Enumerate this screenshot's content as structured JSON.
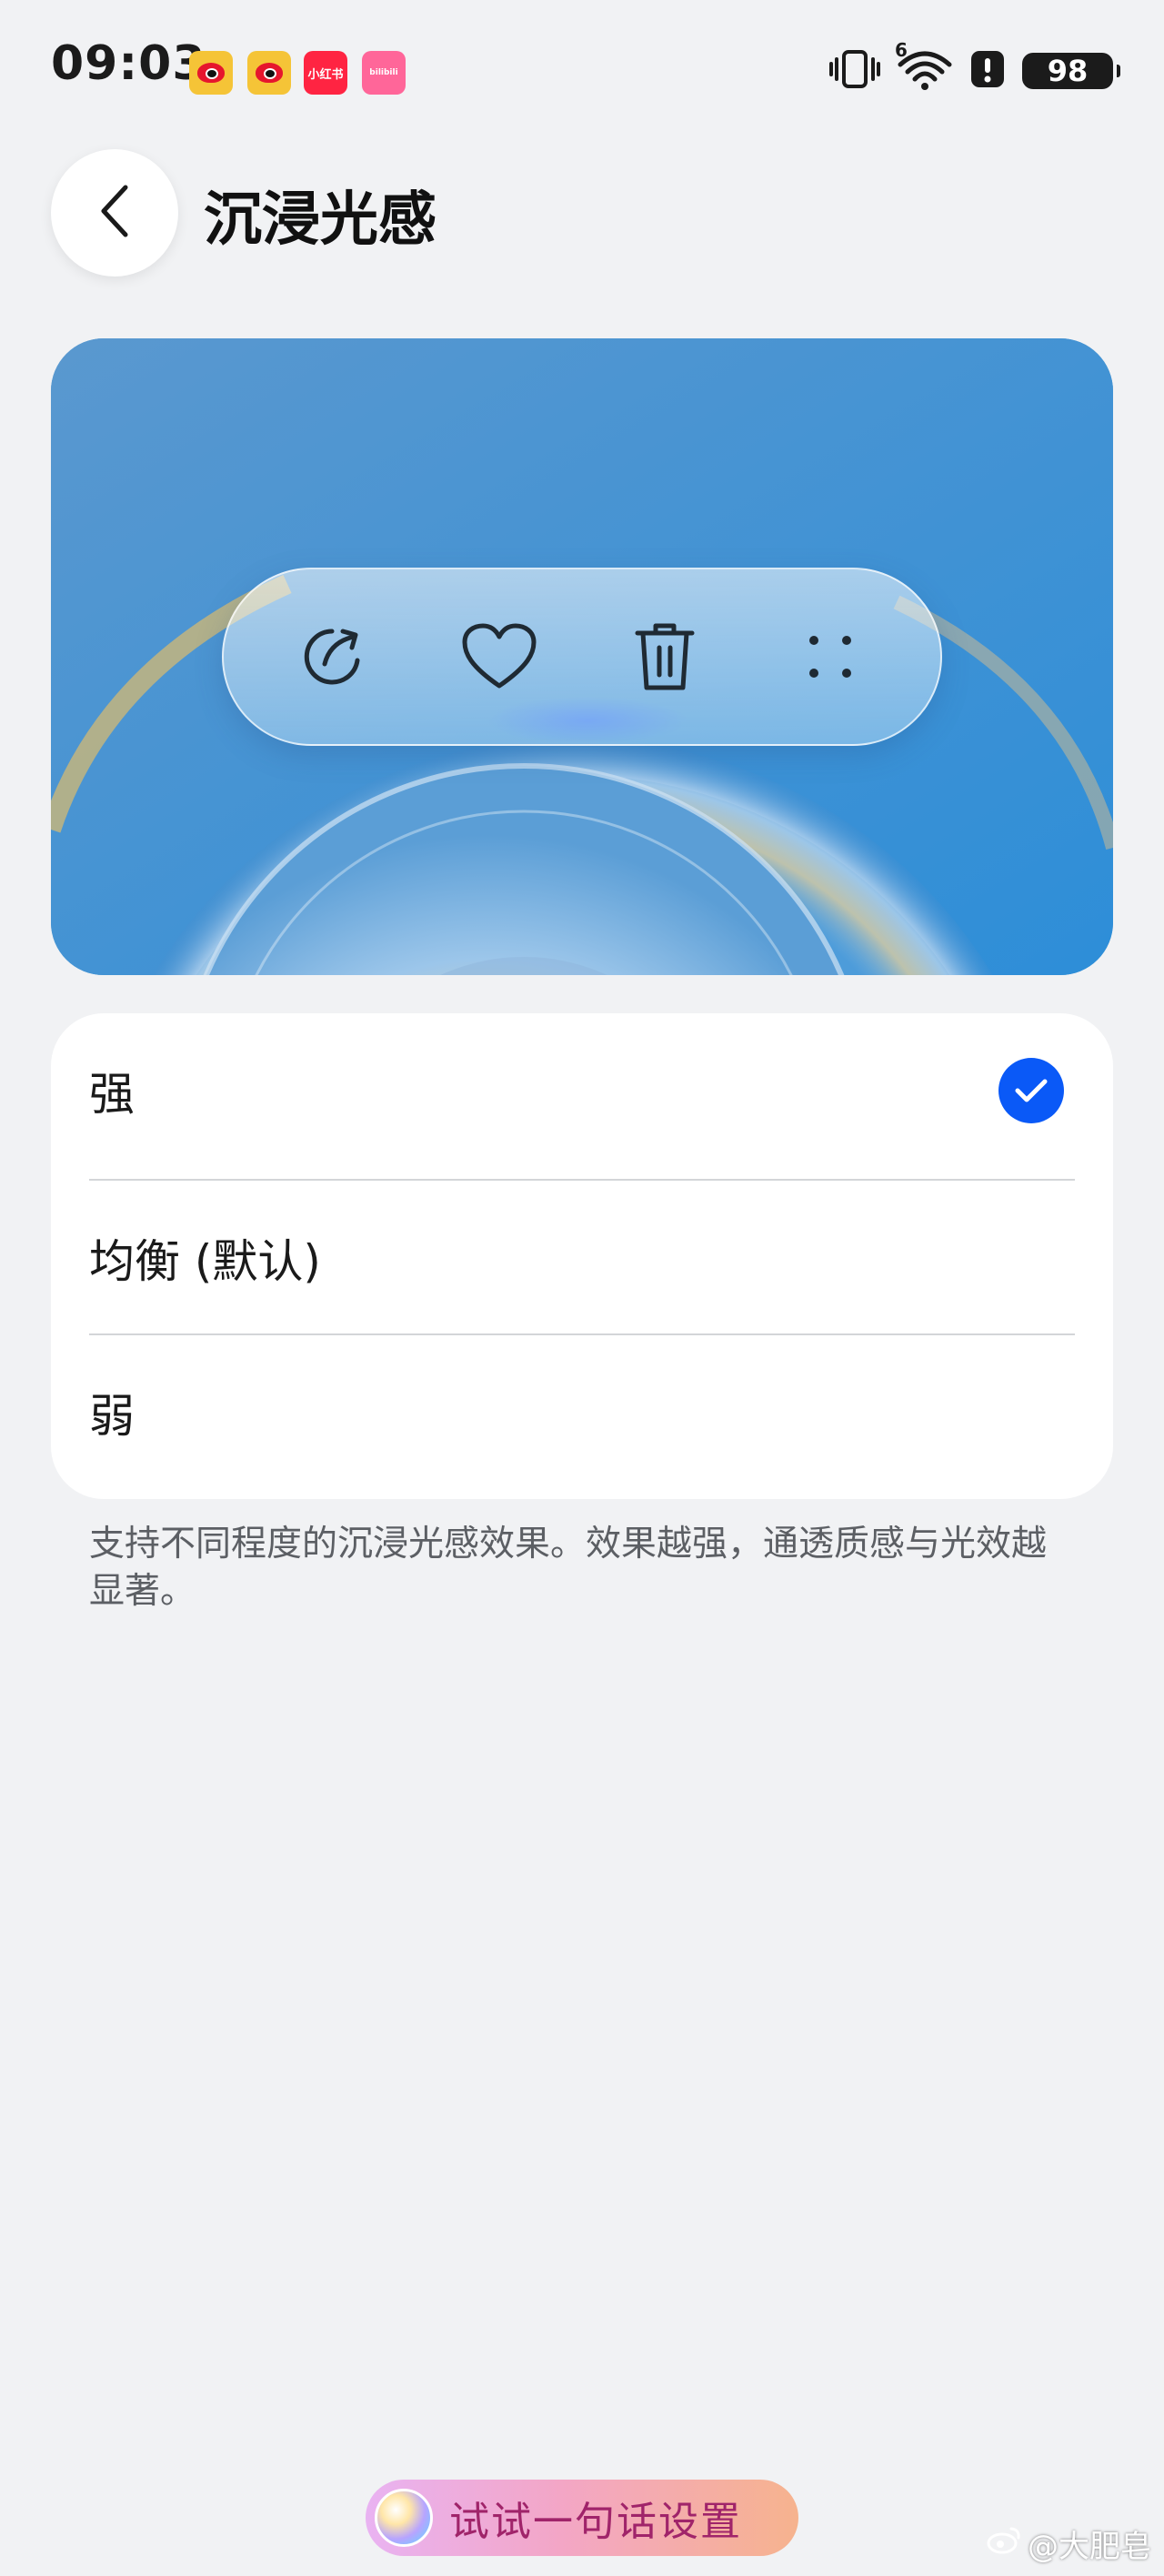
{
  "status_bar": {
    "time": "09:03",
    "notifications": [
      {
        "app": "weibo",
        "icon": "weibo-icon"
      },
      {
        "app": "weibo",
        "icon": "weibo-icon"
      },
      {
        "app": "xiaohongshu",
        "icon": "xiaohongshu-icon",
        "label": "小红书"
      },
      {
        "app": "bilibili",
        "icon": "bilibili-icon",
        "label": "bilibili"
      }
    ],
    "signal_label": "6",
    "battery": "98"
  },
  "header": {
    "title": "沉浸光感",
    "back_icon": "chevron-left-icon"
  },
  "preview": {
    "toolbar_icons": [
      "share-icon",
      "heart-icon",
      "trash-icon",
      "more-icon"
    ]
  },
  "options": {
    "items": [
      {
        "label": "强",
        "selected": true
      },
      {
        "label": "均衡 (默认)",
        "selected": false
      },
      {
        "label": "弱",
        "selected": false
      }
    ]
  },
  "description": "支持不同程度的沉浸光感效果。效果越强，通透质感与光效越显著。",
  "assistant": {
    "label": "试试一句话设置"
  },
  "watermark": {
    "text": "@大肥皂"
  },
  "colors": {
    "background": "#f1f2f4",
    "accent": "#0a59f7",
    "card": "#ffffff"
  }
}
